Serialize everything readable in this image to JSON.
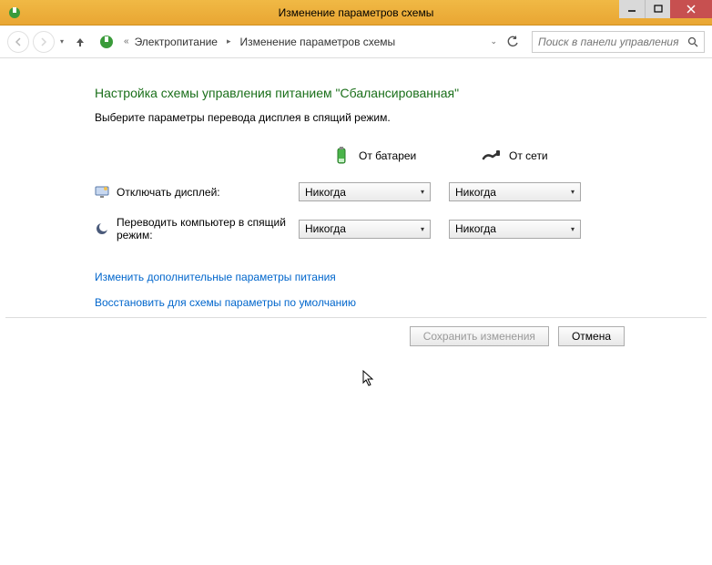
{
  "titlebar": {
    "title": "Изменение параметров схемы"
  },
  "nav": {
    "crumb_prefix": "«",
    "crumb1": "Электропитание",
    "crumb2": "Изменение параметров схемы",
    "search_placeholder": "Поиск в панели управления"
  },
  "main": {
    "heading": "Настройка схемы управления питанием \"Сбалансированная\"",
    "subheading": "Выберите параметры перевода дисплея в спящий режим.",
    "col_battery": "От батареи",
    "col_ac": "От сети",
    "row_display": "Отключать дисплей:",
    "row_sleep": "Переводить компьютер в спящий режим:",
    "value_never": "Никогда",
    "link_advanced": "Изменить дополнительные параметры питания",
    "link_restore": "Восстановить для схемы параметры по умолчанию"
  },
  "footer": {
    "save": "Сохранить изменения",
    "cancel": "Отмена"
  }
}
